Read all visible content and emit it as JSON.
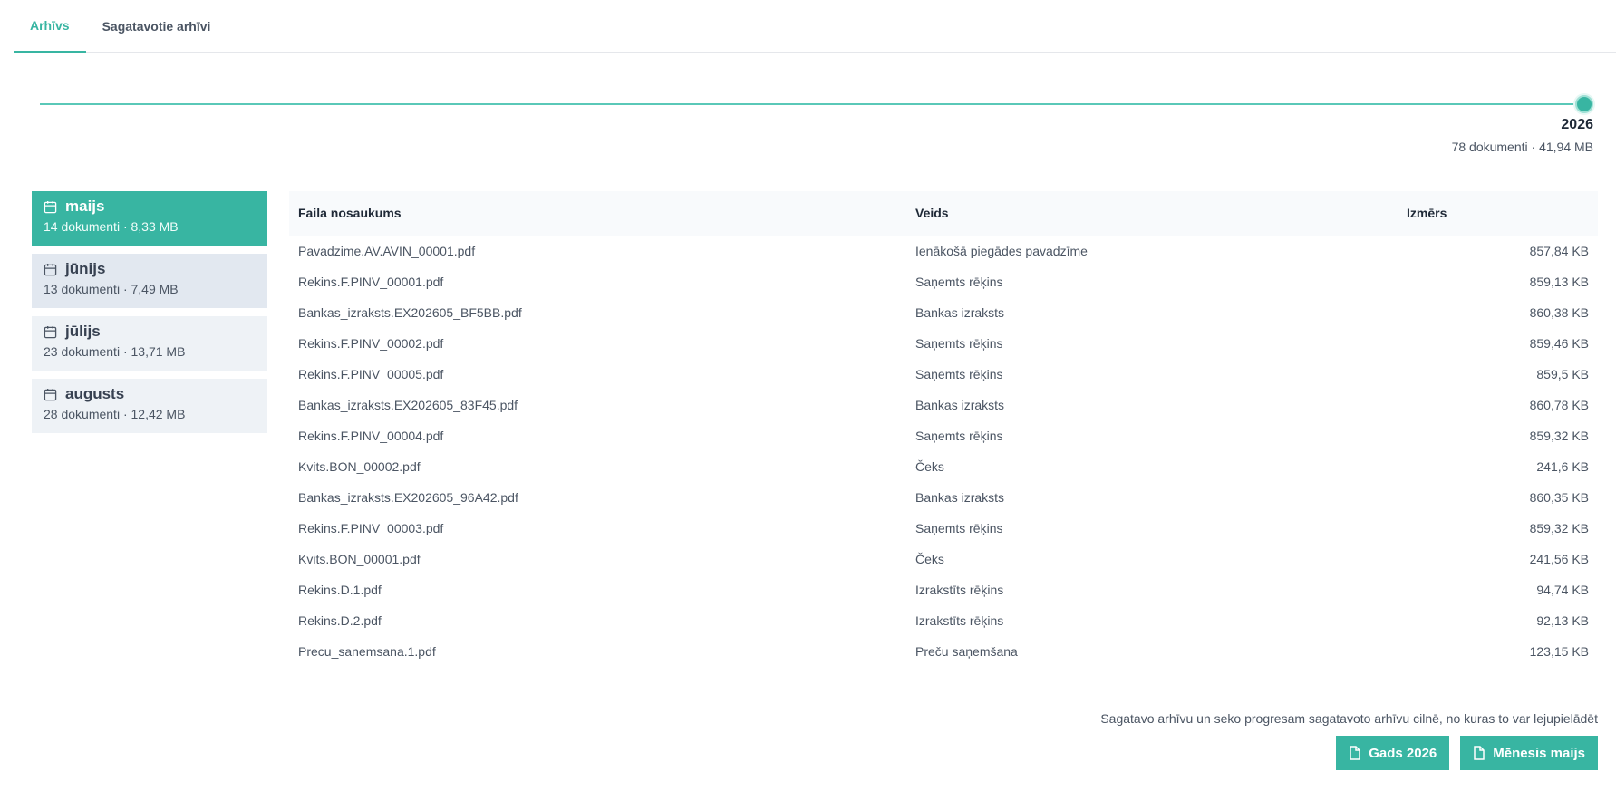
{
  "tabs": [
    {
      "label": "Arhīvs",
      "active": true
    },
    {
      "label": "Sagatavotie arhīvi",
      "active": false
    }
  ],
  "year_slider": {
    "selected_year": "2026",
    "summary": "78 dokumenti · 41,94 MB",
    "accent_color": "#38b5a2"
  },
  "months": [
    {
      "name": "maijs",
      "meta": "14 dokumenti · 8,33 MB",
      "icon": "calendar-icon",
      "state": "active"
    },
    {
      "name": "jūnijs",
      "meta": "13 dokumenti · 7,49 MB",
      "icon": "calendar-icon",
      "state": "hover"
    },
    {
      "name": "jūlijs",
      "meta": "23 dokumenti · 13,71 MB",
      "icon": "calendar-icon",
      "state": "normal"
    },
    {
      "name": "augusts",
      "meta": "28 dokumenti · 12,42 MB",
      "icon": "calendar-icon",
      "state": "normal"
    }
  ],
  "table": {
    "headers": {
      "name": "Faila nosaukums",
      "type": "Veids",
      "size": "Izmērs"
    },
    "rows": [
      {
        "name": "Pavadzime.AV.AVIN_00001.pdf",
        "type": "Ienākošā piegādes pavadzīme",
        "size": "857,84 KB"
      },
      {
        "name": "Rekins.F.PINV_00001.pdf",
        "type": "Saņemts rēķins",
        "size": "859,13 KB"
      },
      {
        "name": "Bankas_izraksts.EX202605_BF5BB.pdf",
        "type": "Bankas izraksts",
        "size": "860,38 KB"
      },
      {
        "name": "Rekins.F.PINV_00002.pdf",
        "type": "Saņemts rēķins",
        "size": "859,46 KB"
      },
      {
        "name": "Rekins.F.PINV_00005.pdf",
        "type": "Saņemts rēķins",
        "size": "859,5 KB"
      },
      {
        "name": "Bankas_izraksts.EX202605_83F45.pdf",
        "type": "Bankas izraksts",
        "size": "860,78 KB"
      },
      {
        "name": "Rekins.F.PINV_00004.pdf",
        "type": "Saņemts rēķins",
        "size": "859,32 KB"
      },
      {
        "name": "Kvits.BON_00002.pdf",
        "type": "Čeks",
        "size": "241,6 KB"
      },
      {
        "name": "Bankas_izraksts.EX202605_96A42.pdf",
        "type": "Bankas izraksts",
        "size": "860,35 KB"
      },
      {
        "name": "Rekins.F.PINV_00003.pdf",
        "type": "Saņemts rēķins",
        "size": "859,32 KB"
      },
      {
        "name": "Kvits.BON_00001.pdf",
        "type": "Čeks",
        "size": "241,56 KB"
      },
      {
        "name": "Rekins.D.1.pdf",
        "type": "Izrakstīts rēķins",
        "size": "94,74 KB"
      },
      {
        "name": "Rekins.D.2.pdf",
        "type": "Izrakstīts rēķins",
        "size": "92,13 KB"
      },
      {
        "name": "Precu_sanemsana.1.pdf",
        "type": "Preču saņemšana",
        "size": "123,15 KB"
      }
    ]
  },
  "footer": {
    "hint": "Sagatavo arhīvu un seko progresam sagatavoto arhīvu cilnē, no kuras to var lejupielādēt",
    "buttons": [
      {
        "label": "Gads 2026",
        "icon": "document-icon"
      },
      {
        "label": "Mēnesis maijs",
        "icon": "document-icon"
      }
    ]
  }
}
